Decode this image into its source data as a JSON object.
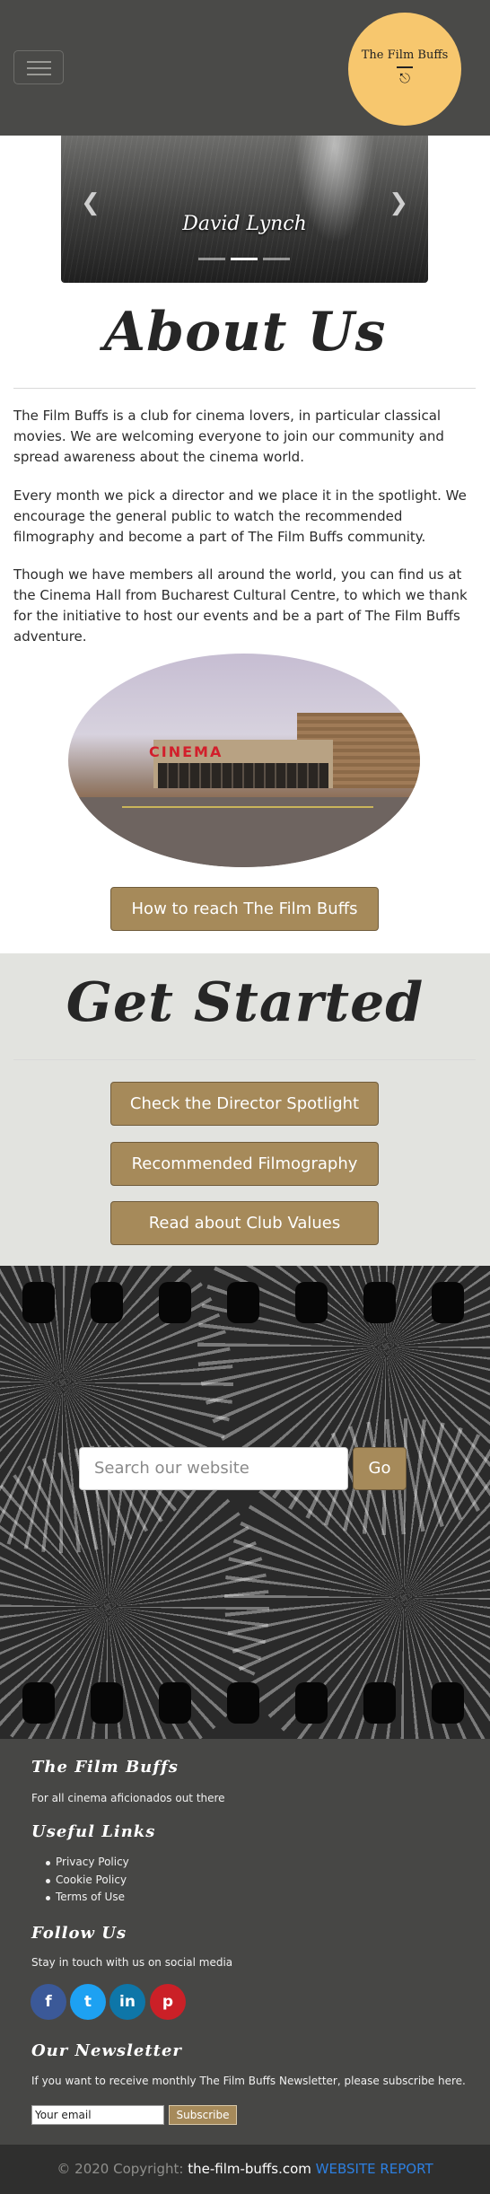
{
  "header": {
    "menu_icon": "hamburger-icon",
    "logo_text": "The Film Buffs",
    "logo_icon": "movie-camera-icon"
  },
  "carousel": {
    "caption": "David Lynch",
    "prev_icon": "chevron-left-icon",
    "next_icon": "chevron-right-icon",
    "indicator_count": 3,
    "active_index": 1
  },
  "about": {
    "title": "About Us",
    "paragraphs": [
      "The Film Buffs is a club for cinema lovers, in particular classical movies. We are welcoming everyone to join our community and spread awareness about the cinema world.",
      "Every month we pick a director and we place it in the spotlight. We encourage the general public to watch the recommended filmography and become a part of The Film Buffs community.",
      "Though we have members all around the world, you can find us at the Cinema Hall from Bucharest Cultural Centre, to which we thank for the initiative to host our events and be a part of The Film Buffs adventure."
    ],
    "cinema_sign": "CINEMA",
    "reach_button": "How to reach The Film Buffs"
  },
  "get_started": {
    "title": "Get Started",
    "buttons": [
      "Check the Director Spotlight",
      "Recommended Filmography",
      "Read about Club Values"
    ]
  },
  "search": {
    "placeholder": "Search our website",
    "button": "Go"
  },
  "footer": {
    "brand_title": "The Film Buffs",
    "brand_text": "For all cinema aficionados out there",
    "links_title": "Useful Links",
    "links": [
      "Privacy Policy",
      "Cookie Policy",
      "Terms of Use"
    ],
    "follow_title": "Follow Us",
    "follow_text": "Stay in touch with us on social media",
    "social": [
      {
        "icon": "facebook-icon",
        "glyph": "f",
        "color": "#3b5998"
      },
      {
        "icon": "twitter-icon",
        "glyph": "t",
        "color": "#1da1f2"
      },
      {
        "icon": "linkedin-icon",
        "glyph": "in",
        "color": "#0e76a8"
      },
      {
        "icon": "pinterest-icon",
        "glyph": "p",
        "color": "#cb2027"
      }
    ],
    "newsletter_title": "Our Newsletter",
    "newsletter_text": "If you want to receive monthly The Film Buffs Newsletter, please subscribe here.",
    "email_value": "Your email",
    "subscribe_button": "Subscribe"
  },
  "bottom_bar": {
    "copyright": "© 2020 Copyright:",
    "site": "the-film-buffs.com",
    "report": "WEBSITE REPORT"
  },
  "colors": {
    "navbar": "#4a4a48",
    "accent_button": "#a68a5a",
    "logo_circle": "#f7c76e",
    "section_gray": "#e2e3df",
    "footer": "#474745",
    "bottom_bar": "#2f2f2e",
    "report_link": "#2d7fe0"
  }
}
